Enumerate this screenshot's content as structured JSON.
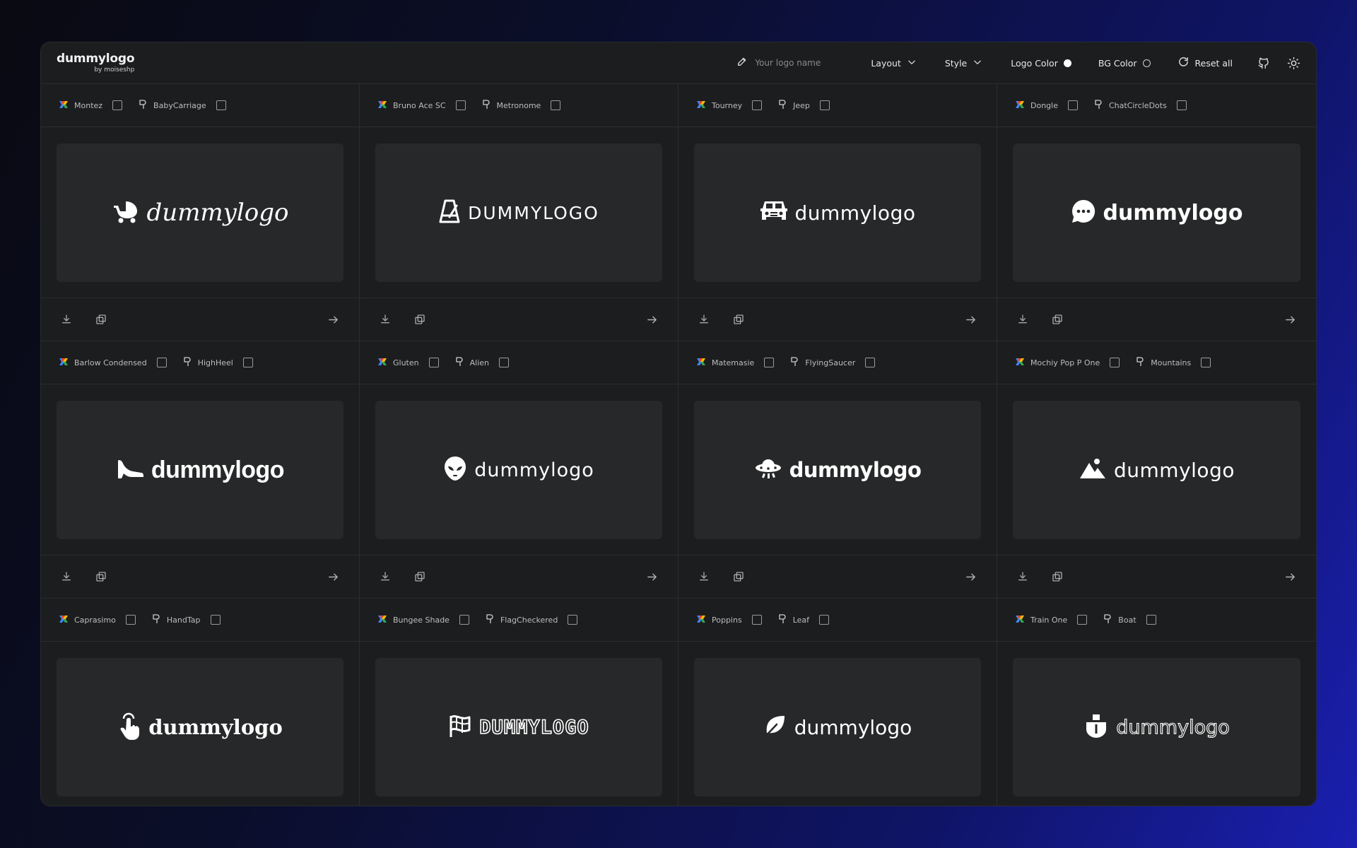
{
  "header": {
    "brand": "dummylogo",
    "brand_by": "by moiseshp",
    "logo_name_placeholder": "Your logo name",
    "layout_label": "Layout",
    "style_label": "Style",
    "logo_color_label": "Logo Color",
    "logo_color": "#ffffff",
    "bg_color_label": "BG Color",
    "reset_label": "Reset all",
    "icons": [
      "pen-icon",
      "chevron-down-icon",
      "refresh-icon",
      "github-icon",
      "sun-icon"
    ]
  },
  "preview_text": "dummylogo",
  "cards": [
    {
      "font": "Montez",
      "icon": "BabyCarriage",
      "icon_name": "baby-carriage-icon"
    },
    {
      "font": "Bruno Ace SC",
      "icon": "Metronome",
      "icon_name": "metronome-icon"
    },
    {
      "font": "Tourney",
      "icon": "Jeep",
      "icon_name": "jeep-icon"
    },
    {
      "font": "Dongle",
      "icon": "ChatCircleDots",
      "icon_name": "chat-circle-dots-icon"
    },
    {
      "font": "Barlow Condensed",
      "icon": "HighHeel",
      "icon_name": "high-heel-icon"
    },
    {
      "font": "Gluten",
      "icon": "Alien",
      "icon_name": "alien-icon"
    },
    {
      "font": "Matemasie",
      "icon": "FlyingSaucer",
      "icon_name": "flying-saucer-icon"
    },
    {
      "font": "Mochiy Pop P One",
      "icon": "Mountains",
      "icon_name": "mountains-icon"
    },
    {
      "font": "Caprasimo",
      "icon": "HandTap",
      "icon_name": "hand-tap-icon"
    },
    {
      "font": "Bungee Shade",
      "icon": "FlagCheckered",
      "icon_name": "flag-checkered-icon"
    },
    {
      "font": "Poppins",
      "icon": "Leaf",
      "icon_name": "leaf-icon"
    },
    {
      "font": "Train One",
      "icon": "Boat",
      "icon_name": "boat-icon"
    }
  ]
}
